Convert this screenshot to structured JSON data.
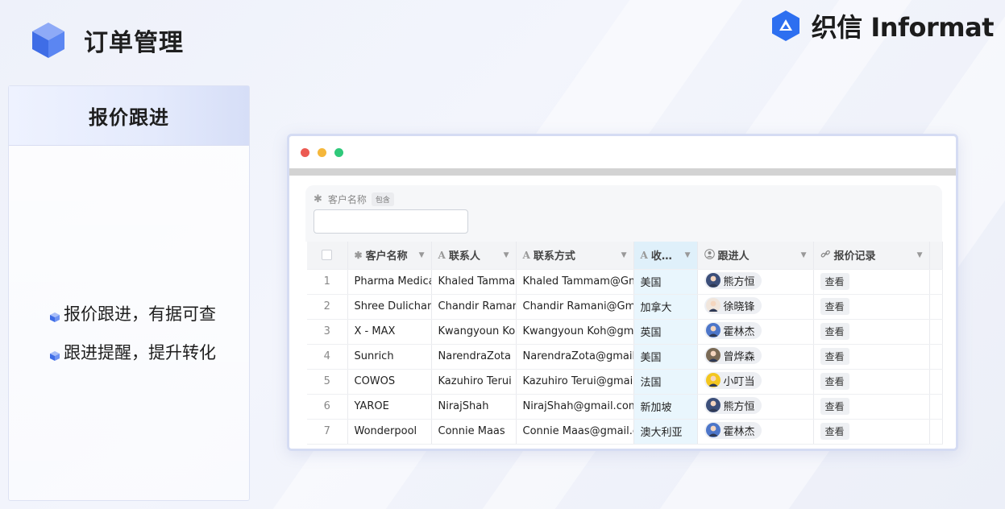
{
  "header": {
    "title": "订单管理"
  },
  "brand": {
    "name": "织信 Informat"
  },
  "left_panel": {
    "title": "报价跟进",
    "features": [
      "报价跟进，有据可查",
      "跟进提醒，提升转化"
    ]
  },
  "window": {
    "dots": [
      "#ec5a52",
      "#f5b73b",
      "#2fc97a"
    ],
    "filter": {
      "label": "客户名称",
      "tag": "包含",
      "value": ""
    },
    "columns": [
      {
        "label": "客户名称",
        "icon": "✱"
      },
      {
        "label": "联系人",
        "icon": "A"
      },
      {
        "label": "联系方式",
        "icon": "A"
      },
      {
        "label": "收…",
        "icon": "A"
      },
      {
        "label": "跟进人",
        "icon": "person-icon"
      },
      {
        "label": "报价记录",
        "icon": "link-icon"
      }
    ],
    "rows": [
      {
        "n": "1",
        "customer": "Pharma Medica",
        "contact": "Khaled Tammam",
        "method": "Khaled Tammam@Gmail",
        "country": "美国",
        "owner": "熊方恒",
        "record": "查看"
      },
      {
        "n": "2",
        "customer": "Shree Dulichand",
        "contact": "Chandir Ramani",
        "method": "Chandir Ramani@Gmail",
        "country": "加拿大",
        "owner": "徐晓锋",
        "record": "查看"
      },
      {
        "n": "3",
        "customer": "X - MAX",
        "contact": "Kwangyoun Koh",
        "method": "Kwangyoun Koh@gmail",
        "country": "英国",
        "owner": "霍林杰",
        "record": "查看"
      },
      {
        "n": "4",
        "customer": "Sunrich",
        "contact": "NarendraZota",
        "method": "NarendraZota@gmail.co",
        "country": "美国",
        "owner": "曾烨森",
        "record": "查看"
      },
      {
        "n": "5",
        "customer": "COWOS",
        "contact": "Kazuhiro Terui",
        "method": "Kazuhiro Terui@gmail.co",
        "country": "法国",
        "owner": "小叮当",
        "record": "查看"
      },
      {
        "n": "6",
        "customer": "YAROE",
        "contact": "NirajShah",
        "method": "NirajShah@gmail.com",
        "country": "新加坡",
        "owner": "熊方恒",
        "record": "查看"
      },
      {
        "n": "7",
        "customer": "Wonderpool",
        "contact": "Connie Maas",
        "method": "Connie Maas@gmail.co",
        "country": "澳大利亚",
        "owner": "霍林杰",
        "record": "查看"
      }
    ]
  }
}
